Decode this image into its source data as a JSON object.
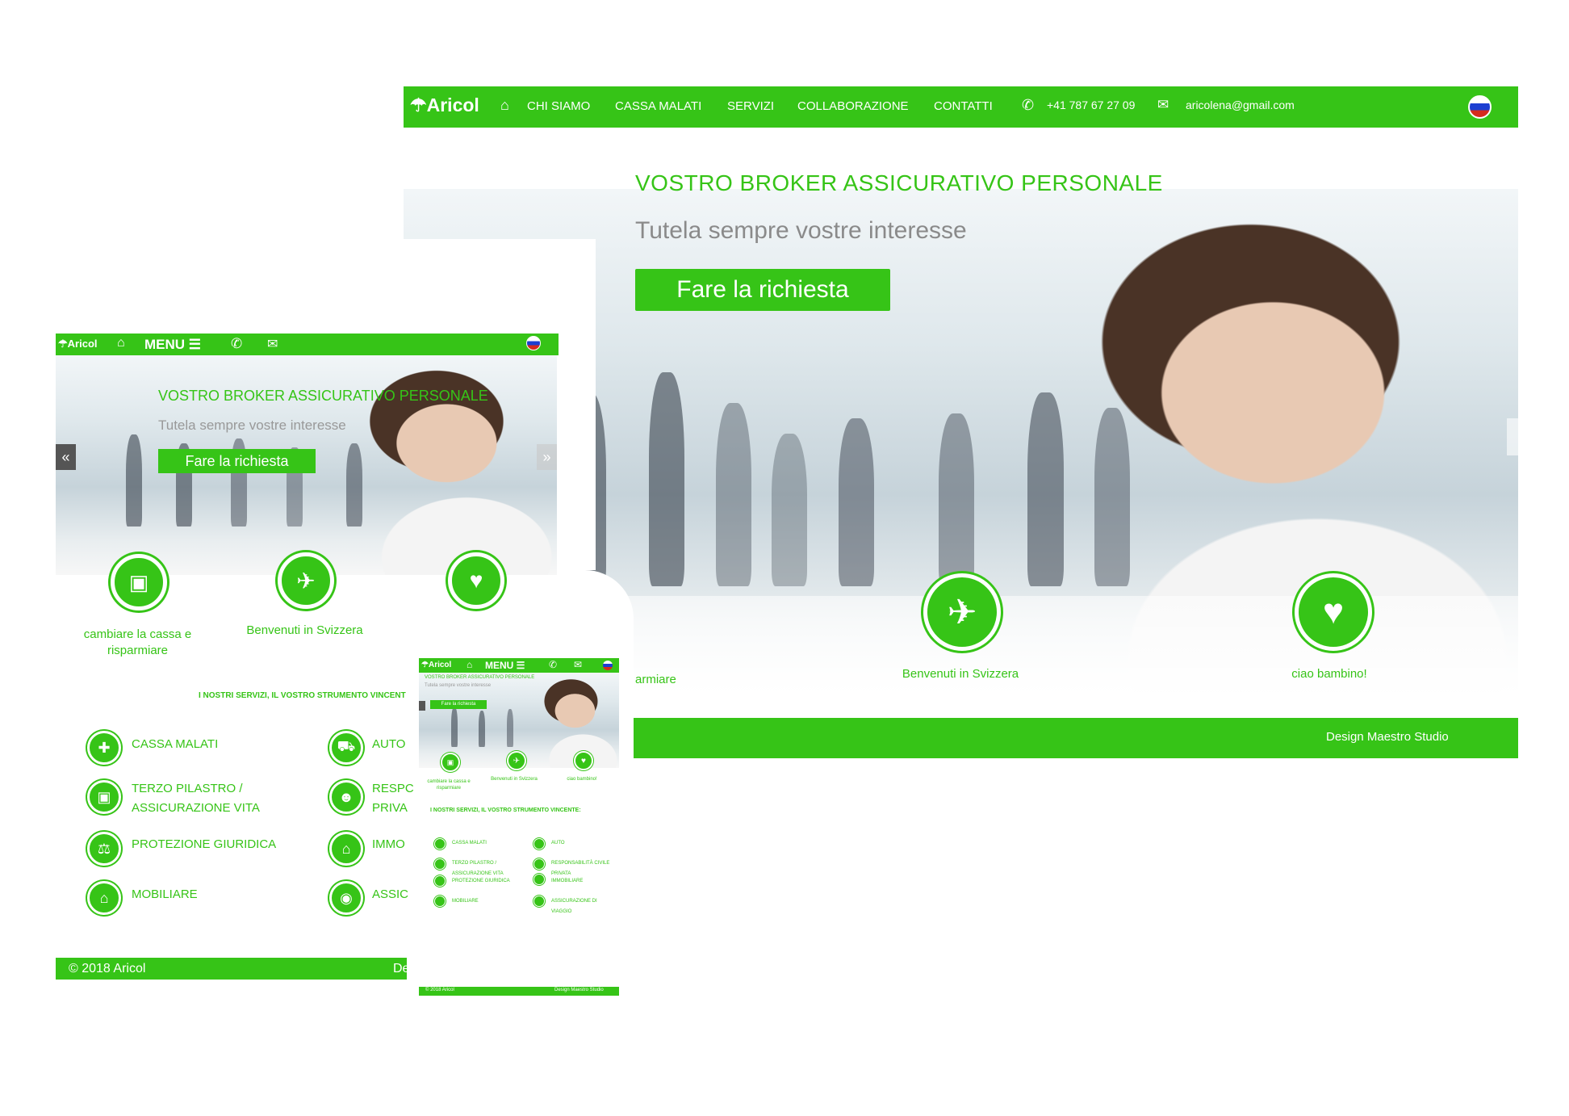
{
  "brand": {
    "name": "Aricol",
    "accent": "#36c417"
  },
  "nav": {
    "items": [
      "CHI SIAMO",
      "CASSA MALATI",
      "SERVIZI",
      "COLLABORAZIONE",
      "CONTATTI"
    ],
    "phone": "+41 787 67 27 09",
    "email": "aricolena@gmail.com"
  },
  "hero": {
    "title": "VOSTRO BROKER ASSICURATIVO PERSONALE",
    "subtitle": "Tutela sempre vostre interesse",
    "cta": "Fare la richiesta"
  },
  "features": [
    "cambiare la cassa e risparmiare",
    "Benvenuti in Svizzera",
    "ciao bambino!"
  ],
  "features_desktop_partial": "armiare",
  "footer": {
    "credit": "Design Maestro Studio",
    "copyright": "© 2018 Aricol"
  },
  "tablet": {
    "menu": "MENU ☰",
    "feature_1": "cambiare la cassa e risparmiare",
    "services_title": "I NOSTRI SERVIZI, IL VOSTRO STRUMENTO VINCENT",
    "services_left": [
      "CASSA MALATI",
      "TERZO PILASTRO / ASSICURAZIONE VITA",
      "PROTEZIONE GIURIDICA",
      "MOBILIARE"
    ],
    "services_right": [
      "AUTO",
      "RESPC",
      "PRIVA",
      "IMMO",
      "ASSIC"
    ],
    "footer_partial": "De"
  },
  "mobile": {
    "menu": "MENU ☰",
    "services_title": "I NOSTRI SERVIZI, IL VOSTRO STRUMENTO VINCENTE:",
    "services_left": [
      "CASSA MALATI",
      "TERZO PILASTRO /",
      "ASSICURAZIONE VITA",
      "PROTEZIONE GIURIDICA",
      "MOBILIARE"
    ],
    "services_right": [
      "AUTO",
      "RESPONSABILITÀ CIVILE",
      "PRIVATA",
      "IMMOBILIARE",
      "ASSICURAZIONE DI",
      "VIAGGIO"
    ]
  },
  "icons": [
    "umbrella-icon",
    "home-icon",
    "phone-icon",
    "envelope-icon",
    "russian-flag-icon",
    "money-icon",
    "plane-icon",
    "heart-icon",
    "medkit-icon",
    "car-icon",
    "scale-icon",
    "users-icon",
    "camera-icon",
    "chevron-left-icon",
    "chevron-right-icon"
  ]
}
